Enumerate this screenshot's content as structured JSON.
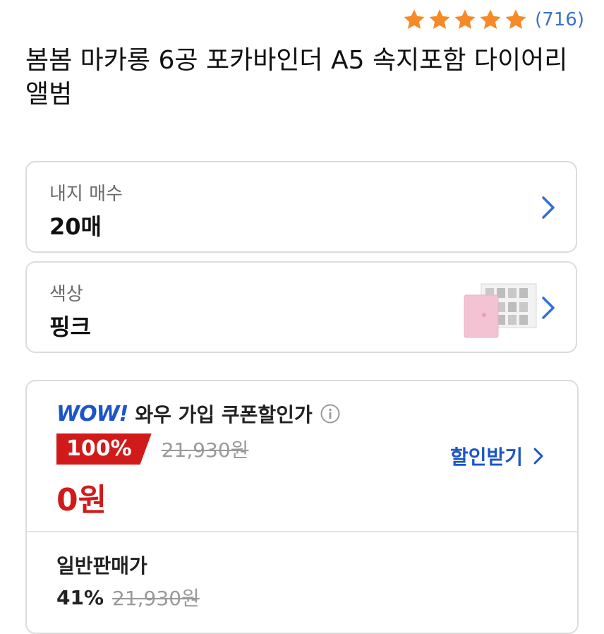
{
  "rating": {
    "stars": 5,
    "star_color": "#f58a27",
    "count_text": "(716)"
  },
  "product": {
    "title": "봄봄 마카롱 6공 포카바인더 A5 속지포함 다이어리 앨범"
  },
  "options": [
    {
      "label": "내지 매수",
      "value": "20매",
      "icon": "chevron-right-icon"
    },
    {
      "label": "색상",
      "value": "핑크",
      "thumbnail": "pink-binder-thumbnail",
      "icon": "chevron-right-icon"
    }
  ],
  "wow": {
    "logo_text": "WOW!",
    "label": "와우 가입 쿠폰할인가",
    "info_icon": "info-icon",
    "discount_badge": "100%",
    "original_price": "21,930원",
    "final_price": "0원",
    "coupon_link": "할인받기",
    "brand_color": "#1b55c8",
    "sale_color": "#d11a1a"
  },
  "general": {
    "label": "일반판매가",
    "discount": "41%",
    "original_price": "21,930원"
  }
}
